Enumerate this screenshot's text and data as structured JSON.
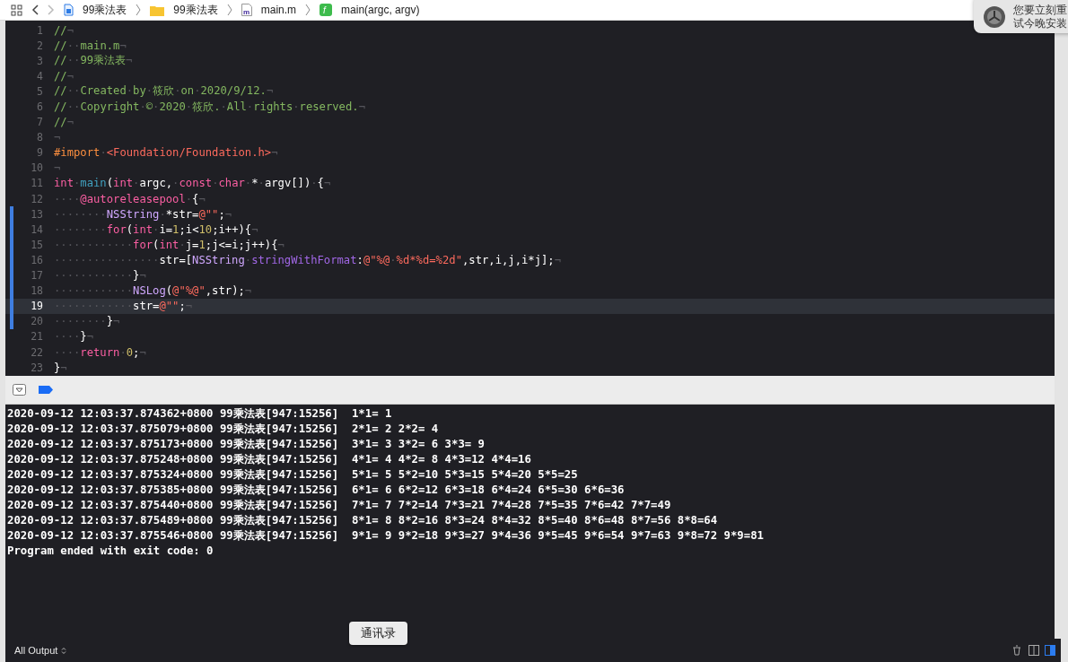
{
  "breadcrumbs": [
    {
      "kind": "project",
      "label": "99乘法表"
    },
    {
      "kind": "folder",
      "label": "99乘法表"
    },
    {
      "kind": "file",
      "label": "main.m",
      "badge": "m"
    },
    {
      "kind": "function",
      "label": "main(argc, argv)",
      "badge": "f"
    }
  ],
  "editor": {
    "lines": [
      {
        "number": "1",
        "changed": false,
        "selected": false,
        "tokens": [
          {
            "kind": "comment",
            "text": "//¬"
          }
        ]
      },
      {
        "number": "2",
        "changed": false,
        "selected": false,
        "tokens": [
          {
            "kind": "comment",
            "text": "//··main.m¬"
          }
        ]
      },
      {
        "number": "3",
        "changed": false,
        "selected": false,
        "tokens": [
          {
            "kind": "comment",
            "text": "//··99乘法表¬"
          }
        ]
      },
      {
        "number": "4",
        "changed": false,
        "selected": false,
        "tokens": [
          {
            "kind": "comment",
            "text": "//¬"
          }
        ]
      },
      {
        "number": "5",
        "changed": false,
        "selected": false,
        "tokens": [
          {
            "kind": "comment",
            "text": "//··Created·by·筱欣·on·2020/9/12.¬"
          }
        ]
      },
      {
        "number": "6",
        "changed": false,
        "selected": false,
        "tokens": [
          {
            "kind": "comment",
            "text": "//··Copyright·©·2020·筱欣.·All·rights·reserved.¬"
          }
        ]
      },
      {
        "number": "7",
        "changed": false,
        "selected": false,
        "tokens": [
          {
            "kind": "comment",
            "text": "//¬"
          }
        ]
      },
      {
        "number": "8",
        "changed": false,
        "selected": false,
        "tokens": [
          {
            "kind": "plain",
            "text": "¬"
          }
        ]
      },
      {
        "number": "9",
        "changed": false,
        "selected": false,
        "tokens": [
          {
            "kind": "preproc",
            "text": "#import"
          },
          {
            "kind": "plain",
            "text": "·"
          },
          {
            "kind": "string",
            "text": "<Foundation/Foundation.h>"
          },
          {
            "kind": "plain",
            "text": "¬"
          }
        ]
      },
      {
        "number": "10",
        "changed": false,
        "selected": false,
        "tokens": [
          {
            "kind": "plain",
            "text": "¬"
          }
        ]
      },
      {
        "number": "11",
        "changed": false,
        "selected": false,
        "tokens": [
          {
            "kind": "keyword",
            "text": "int"
          },
          {
            "kind": "plain",
            "text": "·"
          },
          {
            "kind": "function",
            "text": "main"
          },
          {
            "kind": "plain",
            "text": "("
          },
          {
            "kind": "keyword",
            "text": "int"
          },
          {
            "kind": "plain",
            "text": "·argc,·"
          },
          {
            "kind": "keyword",
            "text": "const"
          },
          {
            "kind": "plain",
            "text": "·"
          },
          {
            "kind": "keyword",
            "text": "char"
          },
          {
            "kind": "plain",
            "text": "·*·argv[])·{¬"
          }
        ]
      },
      {
        "number": "12",
        "changed": false,
        "selected": false,
        "tokens": [
          {
            "kind": "plain",
            "text": "····"
          },
          {
            "kind": "keyword",
            "text": "@autoreleasepool"
          },
          {
            "kind": "plain",
            "text": "·{¬"
          }
        ]
      },
      {
        "number": "13",
        "changed": true,
        "selected": false,
        "tokens": [
          {
            "kind": "plain",
            "text": "········"
          },
          {
            "kind": "type",
            "text": "NSString"
          },
          {
            "kind": "plain",
            "text": "·*str="
          },
          {
            "kind": "string",
            "text": "@\"\""
          },
          {
            "kind": "plain",
            "text": ";¬"
          }
        ]
      },
      {
        "number": "14",
        "changed": true,
        "selected": false,
        "tokens": [
          {
            "kind": "plain",
            "text": "········"
          },
          {
            "kind": "keyword",
            "text": "for"
          },
          {
            "kind": "plain",
            "text": "("
          },
          {
            "kind": "keyword",
            "text": "int"
          },
          {
            "kind": "plain",
            "text": "·i="
          },
          {
            "kind": "number",
            "text": "1"
          },
          {
            "kind": "plain",
            "text": ";i<"
          },
          {
            "kind": "number",
            "text": "10"
          },
          {
            "kind": "plain",
            "text": ";i++){¬"
          }
        ]
      },
      {
        "number": "15",
        "changed": true,
        "selected": false,
        "tokens": [
          {
            "kind": "plain",
            "text": "············"
          },
          {
            "kind": "keyword",
            "text": "for"
          },
          {
            "kind": "plain",
            "text": "("
          },
          {
            "kind": "keyword",
            "text": "int"
          },
          {
            "kind": "plain",
            "text": "·j="
          },
          {
            "kind": "number",
            "text": "1"
          },
          {
            "kind": "plain",
            "text": ";j<=i;j++){¬"
          }
        ]
      },
      {
        "number": "16",
        "changed": true,
        "selected": false,
        "tokens": [
          {
            "kind": "plain",
            "text": "················str=["
          },
          {
            "kind": "type",
            "text": "NSString"
          },
          {
            "kind": "plain",
            "text": "·"
          },
          {
            "kind": "method",
            "text": "stringWithFormat"
          },
          {
            "kind": "plain",
            "text": ":"
          },
          {
            "kind": "string",
            "text": "@\"%@·%d*%d=%2d\""
          },
          {
            "kind": "plain",
            "text": ",str,i,j,i*j];¬"
          }
        ]
      },
      {
        "number": "17",
        "changed": true,
        "selected": false,
        "tokens": [
          {
            "kind": "plain",
            "text": "············}¬"
          }
        ]
      },
      {
        "number": "18",
        "changed": true,
        "selected": false,
        "tokens": [
          {
            "kind": "plain",
            "text": "············"
          },
          {
            "kind": "type",
            "text": "NSLog"
          },
          {
            "kind": "plain",
            "text": "("
          },
          {
            "kind": "string",
            "text": "@\"%@\""
          },
          {
            "kind": "plain",
            "text": ",str);¬"
          }
        ]
      },
      {
        "number": "19",
        "changed": true,
        "selected": true,
        "tokens": [
          {
            "kind": "plain",
            "text": "············str="
          },
          {
            "kind": "string",
            "text": "@\"\""
          },
          {
            "kind": "plain",
            "text": ";¬"
          }
        ]
      },
      {
        "number": "20",
        "changed": true,
        "selected": false,
        "tokens": [
          {
            "kind": "plain",
            "text": "········}¬"
          }
        ]
      },
      {
        "number": "21",
        "changed": false,
        "selected": false,
        "tokens": [
          {
            "kind": "plain",
            "text": "····}¬"
          }
        ]
      },
      {
        "number": "22",
        "changed": false,
        "selected": false,
        "tokens": [
          {
            "kind": "plain",
            "text": "····"
          },
          {
            "kind": "keyword",
            "text": "return"
          },
          {
            "kind": "plain",
            "text": "·"
          },
          {
            "kind": "number",
            "text": "0"
          },
          {
            "kind": "plain",
            "text": ";¬"
          }
        ]
      },
      {
        "number": "23",
        "changed": false,
        "selected": false,
        "tokens": [
          {
            "kind": "plain",
            "text": "}¬"
          }
        ]
      }
    ]
  },
  "console": {
    "lines": [
      "2020-09-12 12:03:37.874362+0800 99乘法表[947:15256]  1*1= 1",
      "2020-09-12 12:03:37.875079+0800 99乘法表[947:15256]  2*1= 2 2*2= 4",
      "2020-09-12 12:03:37.875173+0800 99乘法表[947:15256]  3*1= 3 3*2= 6 3*3= 9",
      "2020-09-12 12:03:37.875248+0800 99乘法表[947:15256]  4*1= 4 4*2= 8 4*3=12 4*4=16",
      "2020-09-12 12:03:37.875324+0800 99乘法表[947:15256]  5*1= 5 5*2=10 5*3=15 5*4=20 5*5=25",
      "2020-09-12 12:03:37.875385+0800 99乘法表[947:15256]  6*1= 6 6*2=12 6*3=18 6*4=24 6*5=30 6*6=36",
      "2020-09-12 12:03:37.875440+0800 99乘法表[947:15256]  7*1= 7 7*2=14 7*3=21 7*4=28 7*5=35 7*6=42 7*7=49",
      "2020-09-12 12:03:37.875489+0800 99乘法表[947:15256]  8*1= 8 8*2=16 8*3=24 8*4=32 8*5=40 8*6=48 8*7=56 8*8=64",
      "2020-09-12 12:03:37.875546+0800 99乘法表[947:15256]  9*1= 9 9*2=18 9*3=27 9*4=36 9*5=45 9*6=54 9*7=63 9*8=72 9*9=81",
      "Program ended with exit code: 0"
    ],
    "filter": "All Output"
  },
  "tooltip": "通讯录",
  "notification": {
    "lines": [
      "您要立刻重",
      "试今晚安装"
    ]
  }
}
